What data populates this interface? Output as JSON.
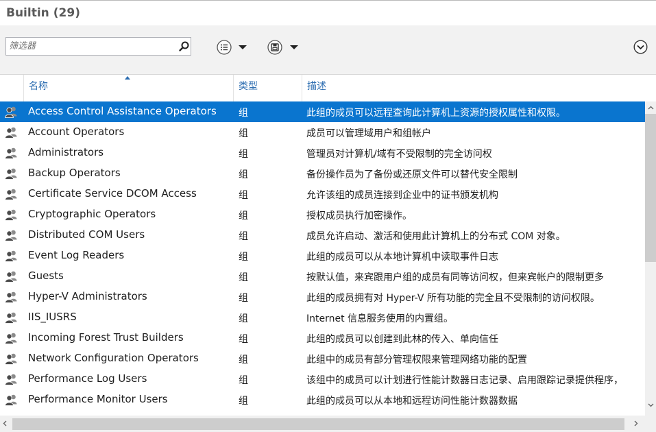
{
  "header": {
    "title": "Builtin",
    "count": "(29)"
  },
  "toolbar": {
    "filter_placeholder": "筛选器",
    "search_icon": "search-icon",
    "list_menu_icon": "list-icon",
    "save_menu_icon": "save-icon",
    "expand_icon": "chevron-down-circle-icon"
  },
  "columns": {
    "name": "名称",
    "type": "类型",
    "desc": "描述"
  },
  "rows": [
    {
      "name": "Access Control Assistance Operators",
      "type": "组",
      "desc": "此组的成员可以远程查询此计算机上资源的授权属性和权限。"
    },
    {
      "name": "Account Operators",
      "type": "组",
      "desc": "成员可以管理域用户和组帐户"
    },
    {
      "name": "Administrators",
      "type": "组",
      "desc": "管理员对计算机/域有不受限制的完全访问权"
    },
    {
      "name": "Backup Operators",
      "type": "组",
      "desc": "备份操作员为了备份或还原文件可以替代安全限制"
    },
    {
      "name": "Certificate Service DCOM Access",
      "type": "组",
      "desc": "允许该组的成员连接到企业中的证书颁发机构"
    },
    {
      "name": "Cryptographic Operators",
      "type": "组",
      "desc": "授权成员执行加密操作。"
    },
    {
      "name": "Distributed COM Users",
      "type": "组",
      "desc": "成员允许启动、激活和使用此计算机上的分布式 COM 对象。"
    },
    {
      "name": "Event Log Readers",
      "type": "组",
      "desc": "此组的成员可以从本地计算机中读取事件日志"
    },
    {
      "name": "Guests",
      "type": "组",
      "desc": "按默认值，来宾跟用户组的成员有同等访问权，但来宾帐户的限制更多"
    },
    {
      "name": "Hyper-V Administrators",
      "type": "组",
      "desc": "此组的成员拥有对 Hyper-V 所有功能的完全且不受限制的访问权限。"
    },
    {
      "name": "IIS_IUSRS",
      "type": "组",
      "desc": "Internet 信息服务使用的内置组。"
    },
    {
      "name": "Incoming Forest Trust Builders",
      "type": "组",
      "desc": "此组的成员可以创建到此林的传入、单向信任"
    },
    {
      "name": "Network Configuration Operators",
      "type": "组",
      "desc": "此组中的成员有部分管理权限来管理网络功能的配置"
    },
    {
      "name": "Performance Log Users",
      "type": "组",
      "desc": "该组中的成员可以计划进行性能计数器日志记录、启用跟踪记录提供程序，"
    },
    {
      "name": "Performance Monitor Users",
      "type": "组",
      "desc": "此组的成员可以从本地和远程访问性能计数器数据"
    }
  ],
  "colors": {
    "selected_row": "#0a75cf",
    "header_text": "#2b6cb0"
  }
}
